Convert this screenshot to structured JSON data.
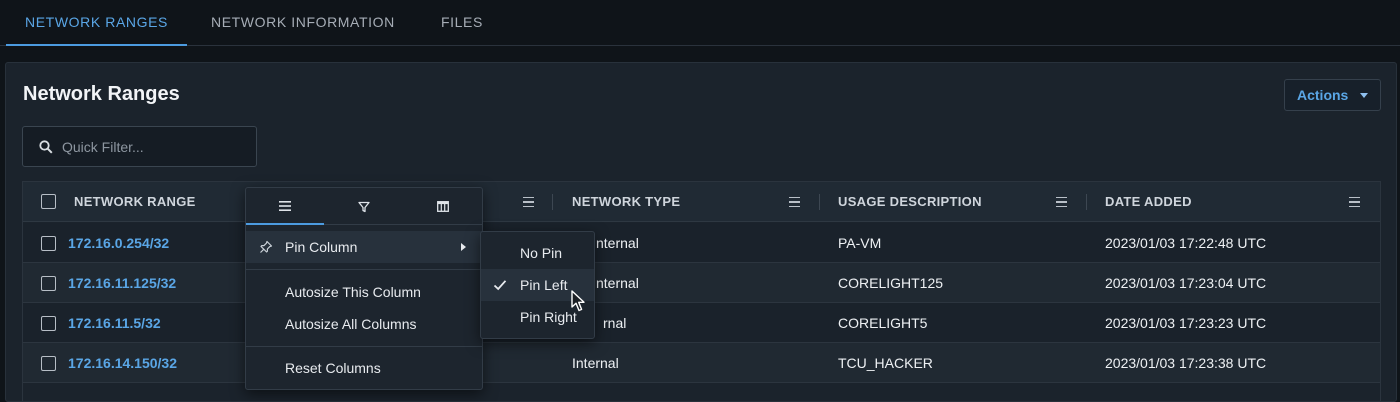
{
  "tabs": [
    "NETWORK RANGES",
    "NETWORK INFORMATION",
    "FILES"
  ],
  "card": {
    "title": "Network Ranges",
    "actions_label": "Actions",
    "filter_placeholder": "Quick Filter..."
  },
  "grid": {
    "columns": [
      "NETWORK RANGE",
      "NETWORK TYPE",
      "USAGE DESCRIPTION",
      "DATE ADDED"
    ],
    "rows": [
      {
        "range": "172.16.0.254/32",
        "type": "nternal",
        "usage": "PA-VM",
        "date": "2023/01/03 17:22:48 UTC"
      },
      {
        "range": "172.16.11.125/32",
        "type": "nternal",
        "usage": "CORELIGHT125",
        "date": "2023/01/03 17:23:04 UTC"
      },
      {
        "range": "172.16.11.5/32",
        "type": "rnal",
        "usage": "CORELIGHT5",
        "date": "2023/01/03 17:23:23 UTC"
      },
      {
        "range": "172.16.14.150/32",
        "type": "Internal",
        "usage": "TCU_HACKER",
        "date": "2023/01/03 17:23:38 UTC"
      }
    ]
  },
  "column_menu": {
    "tab_icons": [
      "menu-lines-icon",
      "filter-funnel-icon",
      "columns-icon"
    ],
    "items": {
      "pin_column": "Pin Column",
      "autosize_this": "Autosize This Column",
      "autosize_all": "Autosize All Columns",
      "reset": "Reset Columns"
    },
    "pin_submenu": {
      "options": [
        "No Pin",
        "Pin Left",
        "Pin Right"
      ],
      "selected": "Pin Left"
    }
  },
  "colors": {
    "accent": "#5aa6e6",
    "background": "#0f1419",
    "card": "#1b232c"
  }
}
